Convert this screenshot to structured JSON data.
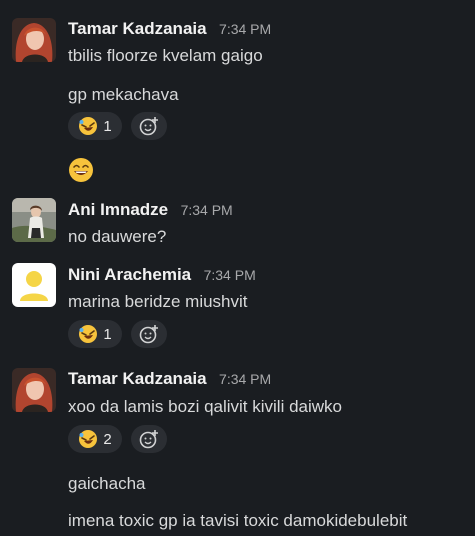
{
  "messages": [
    {
      "author": "Tamar Kadzanaia",
      "time": "7:34 PM",
      "lines": [
        "tbilis floorze kvelam gaigo",
        "gp mekachava"
      ],
      "reaction_count": "1"
    },
    {
      "author": "Ani Imnadze",
      "time": "7:34 PM",
      "lines": [
        "no dauwere?"
      ]
    },
    {
      "author": "Nini Arachemia",
      "time": "7:34 PM",
      "lines": [
        "marina beridze miushvit"
      ],
      "reaction_count": "1"
    },
    {
      "author": "Tamar Kadzanaia",
      "time": "7:34 PM",
      "lines": [
        "xoo da lamis bozi qalivit kivili daiwko",
        "gaichacha",
        "imena toxic gp ia tavisi toxic damokidebulebit"
      ],
      "reaction_count": "2"
    }
  ],
  "icons": {
    "reaction_emoji": "rolling-on-floor-laughing-icon",
    "add_reaction": "add-reaction-icon",
    "big_emoji": "smiling-face-icon"
  },
  "colors": {
    "background": "#1a1d21",
    "reaction_bg": "#2b2e33",
    "default_avatar": "#f5d547"
  }
}
